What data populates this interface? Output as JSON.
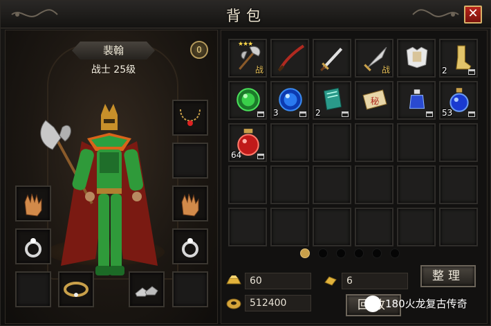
{
  "window": {
    "title": "背包",
    "close_symbol": "✕"
  },
  "character": {
    "name": "裴翰",
    "class_level": "战士 25级",
    "level_badge": "0",
    "equipment": {
      "necklace": "necklace-icon",
      "right_gloves": "glove-icon",
      "left_gloves": "glove-icon",
      "right_ring": "ring-icon",
      "left_ring": "ring-icon",
      "belt": "belt-icon",
      "boots": "boots-icon"
    }
  },
  "bag": {
    "rows": [
      [
        {
          "icon": "axe-icon",
          "qty": "",
          "tag": "战",
          "stars": "★★★",
          "bound": false
        },
        {
          "icon": "saber-icon",
          "qty": "",
          "tag": "",
          "stars": "",
          "bound": false
        },
        {
          "icon": "sword-icon",
          "qty": "",
          "tag": "",
          "stars": "",
          "bound": false
        },
        {
          "icon": "blade-icon",
          "qty": "",
          "tag": "战",
          "stars": "",
          "bound": false
        },
        {
          "icon": "armor-icon",
          "qty": "",
          "tag": "",
          "stars": "",
          "bound": false
        },
        {
          "icon": "boots-icon",
          "qty": "2",
          "tag": "",
          "stars": "",
          "bound": true
        }
      ],
      [
        {
          "icon": "green-orb-icon",
          "qty": "",
          "tag": "",
          "stars": "",
          "bound": true
        },
        {
          "icon": "blue-orb-icon",
          "qty": "3",
          "tag": "",
          "stars": "",
          "bound": true
        },
        {
          "icon": "book-icon",
          "qty": "2",
          "tag": "",
          "stars": "",
          "bound": true
        },
        {
          "icon": "scroll-icon",
          "qty": "",
          "tag": "",
          "stars": "",
          "bound": false
        },
        {
          "icon": "blue-potion-small-icon",
          "qty": "",
          "tag": "",
          "stars": "",
          "bound": true
        },
        {
          "icon": "blue-potion-icon",
          "qty": "53",
          "tag": "",
          "stars": "",
          "bound": true
        }
      ],
      [
        {
          "icon": "red-potion-icon",
          "qty": "64",
          "tag": "",
          "stars": "",
          "bound": true
        }
      ]
    ],
    "total_rows": 5,
    "columns": 6,
    "pages": 6,
    "current_page": 1
  },
  "currency": {
    "gold": "60",
    "gold_ingot": "6",
    "coins": "512400"
  },
  "buttons": {
    "sort": "整理",
    "recycle": "回收"
  },
  "watermark": {
    "text": "180火龙复古传奇"
  },
  "colors": {
    "close": "#b8241b",
    "gold": "#e9c25a",
    "page_active": "#c9a04a"
  }
}
